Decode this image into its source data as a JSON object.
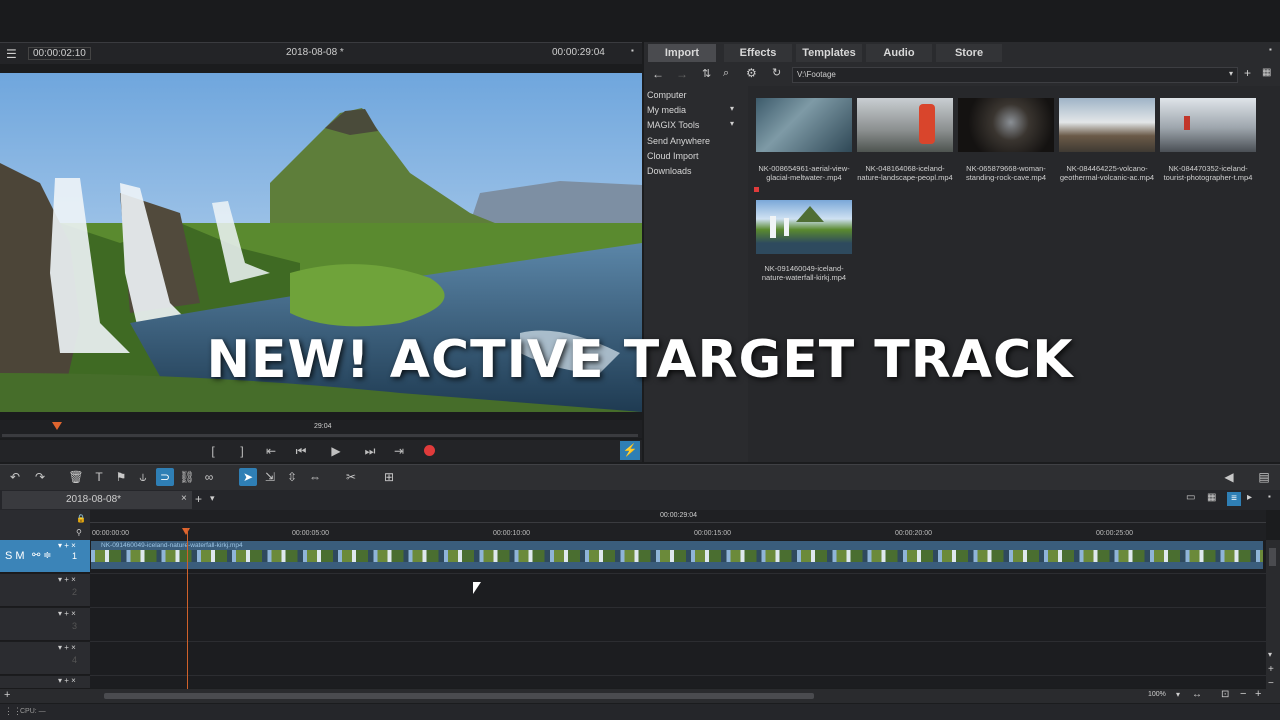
{
  "preview": {
    "timecode_current": "00:00:02:10",
    "project_title": "2018-08-08 *",
    "timecode_total": "00:00:29:04",
    "scrub_marker": "29:04"
  },
  "media_pool": {
    "tabs": [
      "Import",
      "Effects",
      "Templates",
      "Audio",
      "Store"
    ],
    "path": "V:\\Footage",
    "nav": [
      "Computer",
      "My media",
      "MAGIX Tools",
      "Send Anywhere",
      "Cloud Import",
      "Downloads"
    ],
    "files": [
      "NK-008654961-aerial-view-glacial-meltwater-.mp4",
      "NK-048164068-iceland-nature-landscape-peopl.mp4",
      "NK-065879668-woman-standing-rock-cave.mp4",
      "NK-084464225-volcano-geothermal-volcanic-ac.mp4",
      "NK-084470352-iceland-tourist-photographer-t.mp4",
      "NK-091460049-iceland-nature-waterfall-kirkj.mp4"
    ]
  },
  "overlay": {
    "title": "NEW! ACTIVE TARGET TRACK"
  },
  "project_tab": {
    "label": "2018-08-08*"
  },
  "timeline": {
    "top_timecode": "00:00:29:04",
    "ruler_labels": [
      "00:00:00:00",
      "00:00:05:00",
      "00:00:10:00",
      "00:00:15:00",
      "00:00:20:00",
      "00:00:25:00"
    ],
    "clip_name": "NK-091460049-iceland-nature-waterfall-kirkj.mp4",
    "tracks": [
      "1",
      "2",
      "3",
      "4"
    ],
    "track1_buttons": "S M",
    "zoom": "100%"
  },
  "status": {
    "cpu": "CPU: —"
  },
  "colors": {
    "accent": "#2f7fb5",
    "playhead": "#d0612a",
    "record": "#e03b3b",
    "clip": "#3a5d7c"
  }
}
